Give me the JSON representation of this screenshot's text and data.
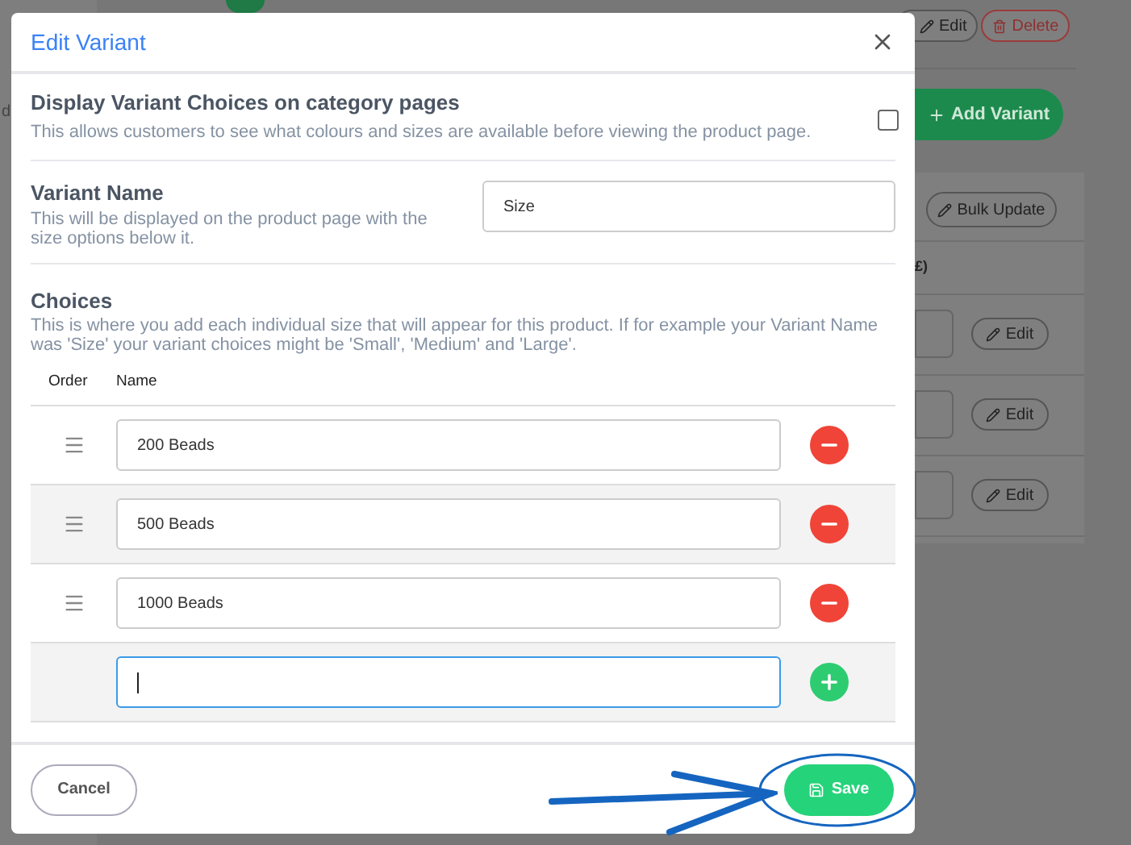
{
  "background": {
    "left_fragment": "d",
    "top_buttons": [
      {
        "kind": "edit",
        "label": "Edit"
      },
      {
        "kind": "delete",
        "label": "Delete"
      }
    ],
    "add_button": "Add Variant",
    "bulk_button": "Bulk Update",
    "column_fragment": "£)",
    "row_buttons": [
      "Edit",
      "Edit",
      "Edit"
    ]
  },
  "modal": {
    "title": "Edit Variant",
    "display_option": {
      "title": "Display Variant Choices on category pages",
      "description": "This allows customers to see what colours and sizes are available before viewing the product page.",
      "checked": false
    },
    "variant_name": {
      "title": "Variant Name",
      "description": "This will be displayed on the product page with the size options below it.",
      "value": "Size"
    },
    "choices": {
      "title": "Choices",
      "description": "This is where you add each individual size that will appear for this product. If for example your Variant Name was 'Size' your variant choices might be 'Small', 'Medium' and 'Large'.",
      "columns": [
        "Order",
        "Name"
      ],
      "rows": [
        {
          "kind": "existing",
          "value": "200 Beads"
        },
        {
          "kind": "existing",
          "value": "500 Beads"
        },
        {
          "kind": "existing",
          "value": "1000 Beads"
        },
        {
          "kind": "new",
          "value": "",
          "focused": true
        }
      ]
    },
    "buttons": {
      "cancel": "Cancel",
      "save": "Save"
    }
  }
}
